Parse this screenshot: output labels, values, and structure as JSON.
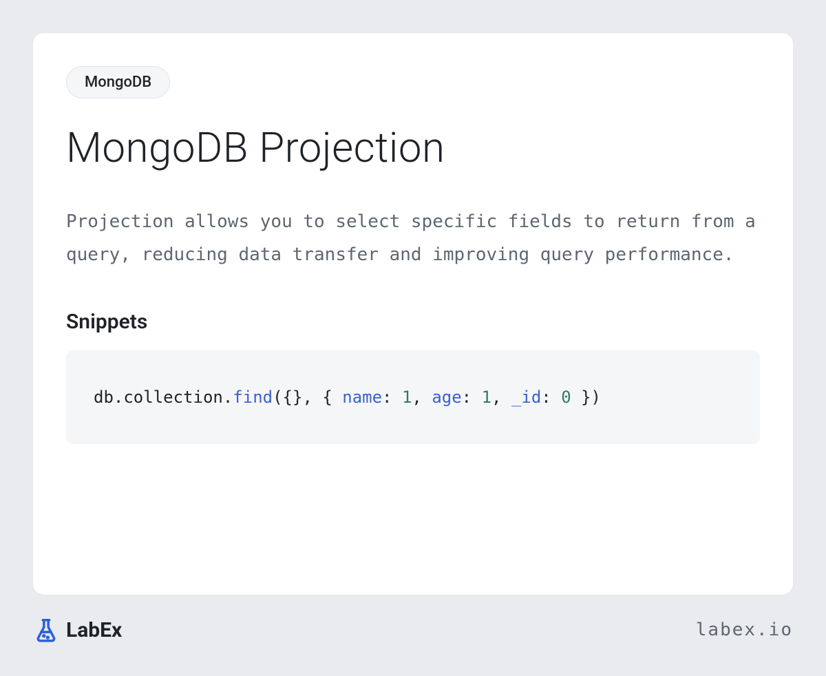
{
  "tag": "MongoDB",
  "title": "MongoDB Projection",
  "description": "Projection allows you to select specific fields to return from a query, reducing data transfer and improving query performance.",
  "snippets_heading": "Snippets",
  "code": {
    "prefix": "db.collection.",
    "fn": "find",
    "open": "({}, { ",
    "k1": "name",
    "sep1": ": ",
    "v1": "1",
    "comma1": ", ",
    "k2": "age",
    "sep2": ": ",
    "v2": "1",
    "comma2": ", ",
    "k3": "_id",
    "sep3": ": ",
    "v3": "0",
    "close": " })"
  },
  "brand": "LabEx",
  "site_url": "labex.io"
}
